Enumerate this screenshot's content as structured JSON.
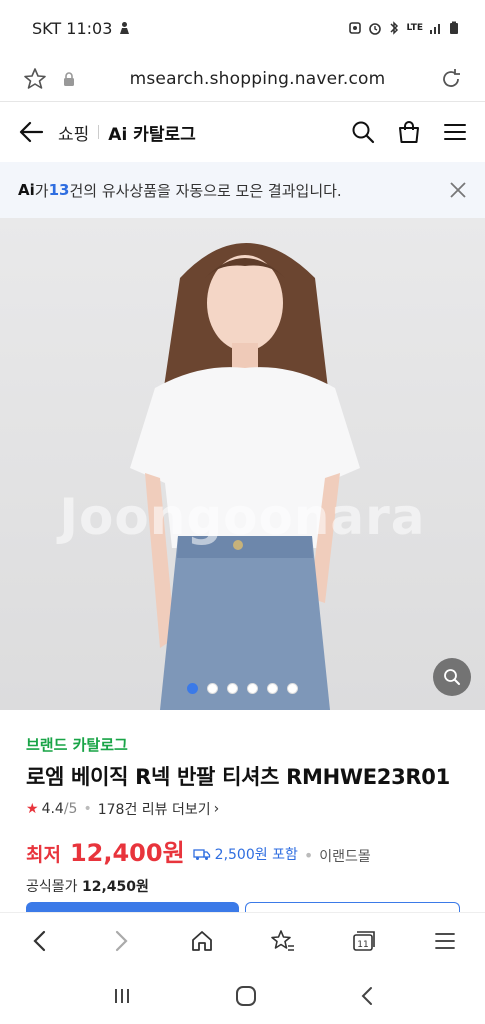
{
  "status": {
    "carrier_time": "SKT 11:03",
    "network": "LTE"
  },
  "browser": {
    "url": "msearch.shopping.naver.com"
  },
  "header": {
    "section": "쇼핑",
    "title": "Ai 카탈로그"
  },
  "ai_banner": {
    "ai_label": "Ai",
    "prefix": "가 ",
    "count": "13",
    "suffix": "건의 유사상품을 자동으로 모은 결과입니다."
  },
  "gallery": {
    "watermark": "Joongoonara",
    "total_images": 6,
    "active_index": 0
  },
  "product": {
    "brand": "브랜드 카탈로그",
    "name": "로엠 베이직 R넥 반팔 티셔츠 RMHWE23R01",
    "rating": "4.4",
    "rating_max": "/5",
    "reviews": "178건 리뷰 더보기",
    "price_label": "최저",
    "price": "12,400원",
    "shipping": "2,500원 포함",
    "seller": "이랜드몰",
    "official_label": "공식몰가",
    "official_price": "12,450원"
  },
  "colors": {
    "accent": "#3b7ae8",
    "price": "#e8343c",
    "brand": "#19a447"
  }
}
